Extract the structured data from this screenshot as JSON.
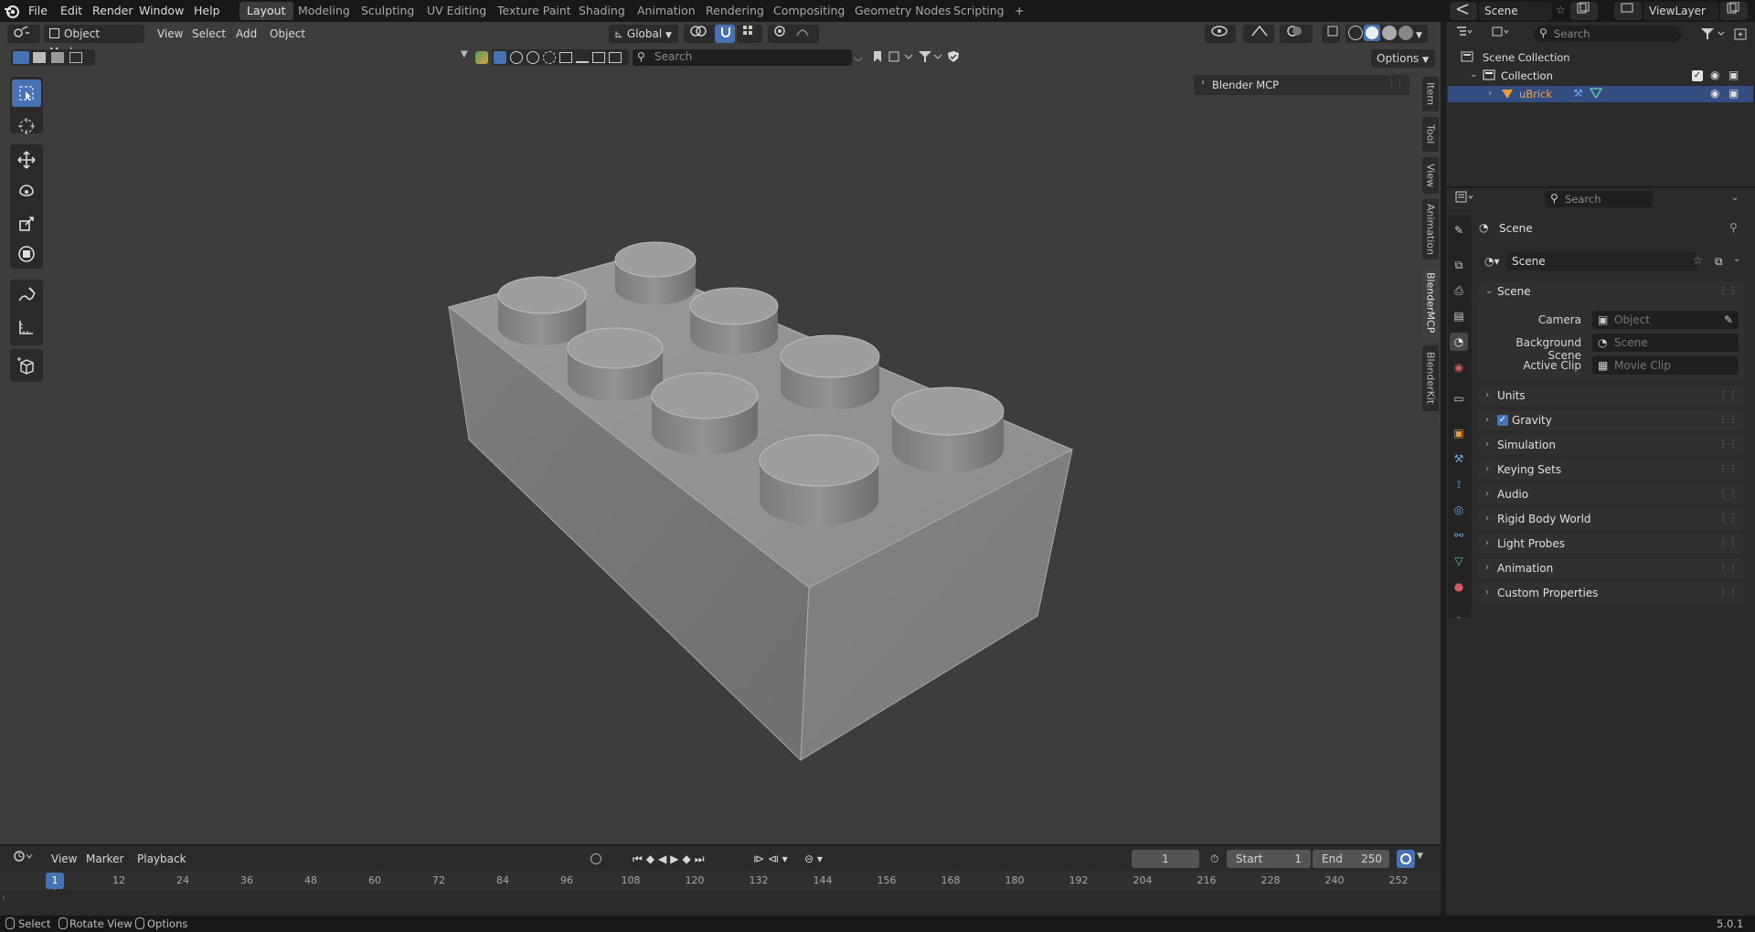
{
  "menus": [
    "File",
    "Edit",
    "Render",
    "Window",
    "Help"
  ],
  "workspaces": [
    "Layout",
    "Modeling",
    "Sculpting",
    "UV Editing",
    "Texture Paint",
    "Shading",
    "Animation",
    "Rendering",
    "Compositing",
    "Geometry Nodes",
    "Scripting"
  ],
  "workspace_add": "+",
  "top_right": {
    "scene": "Scene",
    "view_layer": "ViewLayer",
    "search_placeholder": "Search"
  },
  "viewport_header": {
    "mode": "Object Mode",
    "menus": [
      "View",
      "Select",
      "Add",
      "Object"
    ],
    "orientation": "Global",
    "options_label": "Options",
    "search_placeholder": "Search"
  },
  "npanel": {
    "panel_title": "Blender MCP",
    "tabs": [
      "Item",
      "Tool",
      "View",
      "Animation",
      "BlenderMCP",
      "BlenderKit"
    ],
    "active_tab": "BlenderMCP"
  },
  "outliner": {
    "root": "Scene Collection",
    "collection": "Collection",
    "object": "uBrick"
  },
  "properties": {
    "search_placeholder": "Search",
    "context_title": "Scene",
    "scene_selector": "Scene",
    "scene_panel": "Scene",
    "camera_label": "Camera",
    "camera_placeholder": "Object",
    "bg_label": "Background Scene",
    "bg_placeholder": "Scene",
    "clip_label": "Active Clip",
    "clip_placeholder": "Movie Clip",
    "panels": [
      "Units",
      "Gravity",
      "Simulation",
      "Keying Sets",
      "Audio",
      "Rigid Body World",
      "Light Probes",
      "Animation",
      "Custom Properties"
    ],
    "gravity_checked": true
  },
  "timeline": {
    "menus": [
      "View",
      "Marker",
      "Playback"
    ],
    "current_frame": "1",
    "start_label": "Start",
    "start_value": "1",
    "end_label": "End",
    "end_value": "250",
    "ticks": [
      "1",
      "12",
      "24",
      "36",
      "48",
      "60",
      "72",
      "84",
      "96",
      "108",
      "120",
      "132",
      "144",
      "156",
      "168",
      "180",
      "192",
      "204",
      "216",
      "228",
      "240",
      "252"
    ]
  },
  "statusbar": {
    "select": "Select",
    "rotate": "Rotate View",
    "options": "Options",
    "version": "5.0.1"
  },
  "colors": {
    "accent": "#4772b3",
    "selected_object": "#ed9b3a",
    "active_row": "#334d80"
  }
}
